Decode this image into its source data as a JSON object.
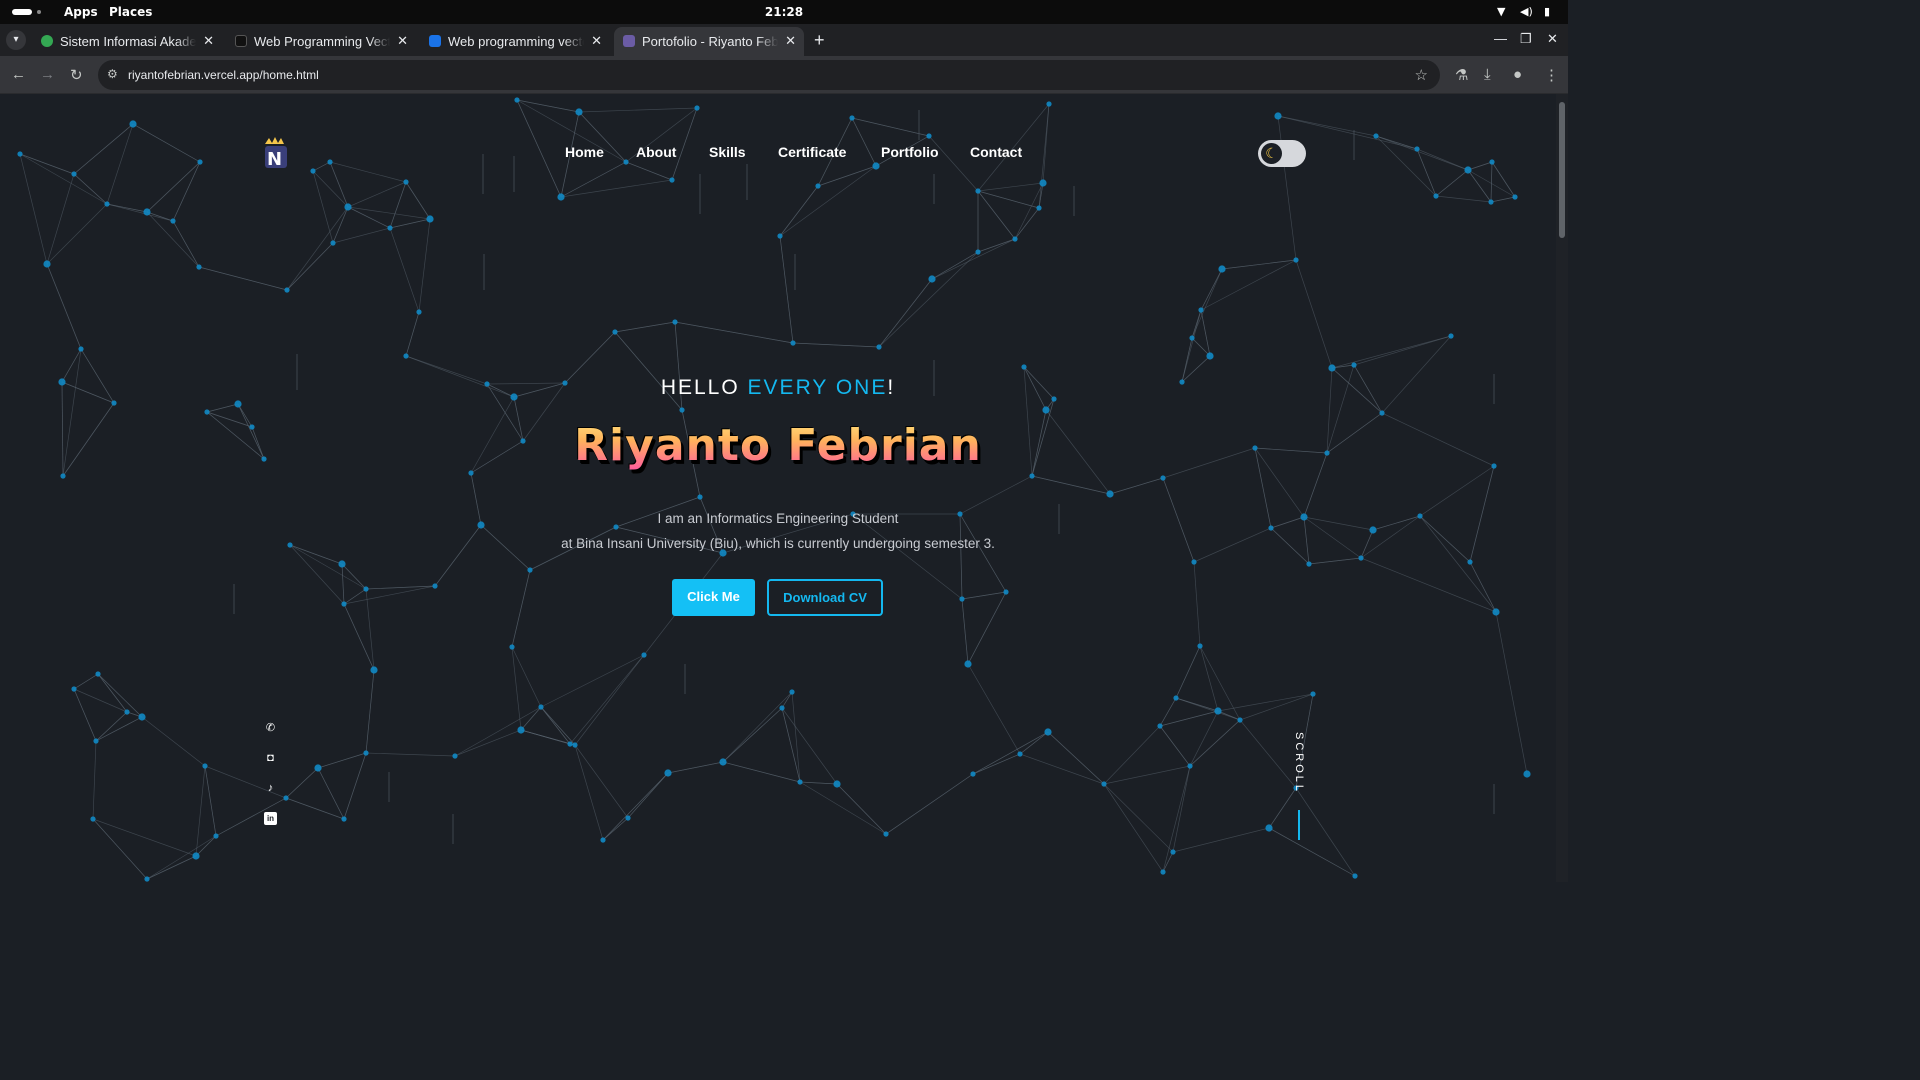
{
  "system_bar": {
    "apps_label": "Apps",
    "places_label": "Places",
    "clock": "21:28"
  },
  "browser": {
    "tabs": [
      {
        "title": "Sistem Informasi Akademik",
        "favicon_color": "#34a853",
        "active": false
      },
      {
        "title": "Web Programming Vector",
        "favicon_color": "#1a1a1a",
        "active": false
      },
      {
        "title": "Web programming vector",
        "favicon_color": "#1a73e8",
        "active": false
      },
      {
        "title": "Portofolio - Riyanto Febrian",
        "favicon_color": "#6b5ca5",
        "active": true
      }
    ],
    "url": "riyantofebrian.vercel.app/home.html"
  },
  "site": {
    "nav": [
      "Home",
      "About",
      "Skills",
      "Certificate",
      "Portfolio",
      "Contact"
    ],
    "theme_icon": "moon-icon",
    "hero": {
      "greeting": "HELLO",
      "greeting_accent": "EVERY ONE",
      "greeting_end": "!",
      "name": "Riyanto Febrian",
      "desc_line1": "I am an Informatics Engineering Student",
      "desc_line2": "at Bina Insani University (Biu), which is currently undergoing semester 3.",
      "cta_primary": "Click Me",
      "cta_secondary": "Download CV"
    },
    "social_icons": [
      "whatsapp-icon",
      "instagram-icon",
      "tiktok-icon",
      "linkedin-icon"
    ],
    "scroll_label": "SCROLL",
    "colors": {
      "accent": "#14b8f0",
      "background": "#1b1f25",
      "node": "#1188c4"
    }
  }
}
